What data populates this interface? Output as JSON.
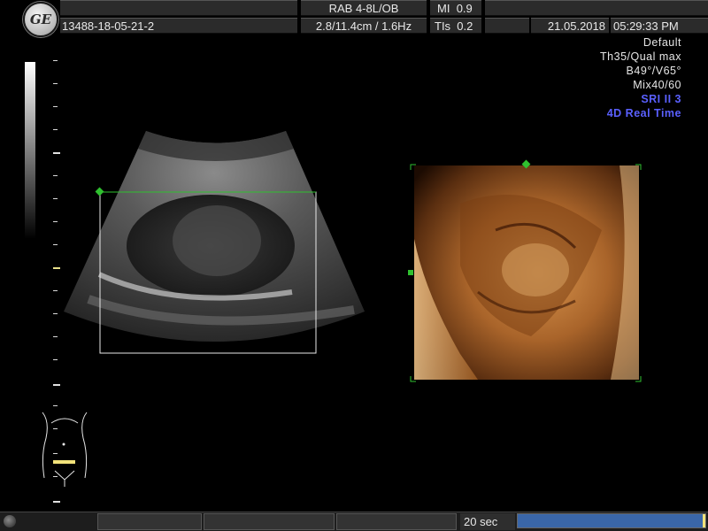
{
  "header": {
    "logo_text": "GE",
    "probe": "RAB 4-8L/OB",
    "mi_label": "MI",
    "mi_value": "0.9",
    "patient_id": "13488-18-05-21-2",
    "depth_freq": "2.8/11.4cm / 1.6Hz",
    "tis_label": "TIs",
    "tis_value": "0.2",
    "date": "21.05.2018",
    "time": "05:29:33 PM"
  },
  "params": {
    "preset": "Default",
    "thickness_quality": "Th35/Qual max",
    "angles": "B49°/V65°",
    "mix": "Mix40/60",
    "sri": "SRI II 3",
    "mode": "4D Real Time"
  },
  "footer": {
    "cine_duration": "20 sec",
    "cine_progress": 0.99
  },
  "colors": {
    "accent_blue": "#5a60ff",
    "roi_green": "#2fc02f",
    "progress_blue": "#3a66a8",
    "render_orange": "#c0722a"
  }
}
